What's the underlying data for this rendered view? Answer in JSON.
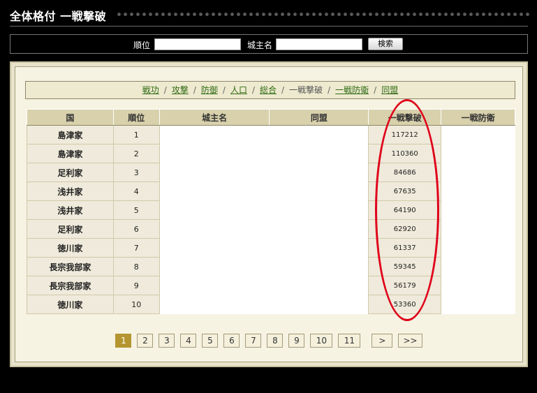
{
  "header": {
    "title": "全体格付 一戦撃破"
  },
  "search": {
    "rank_label": "順位",
    "lord_label": "城主名",
    "rank_value": "",
    "lord_value": "",
    "button_label": "検索"
  },
  "tabs": [
    {
      "label": "戦功",
      "active": false
    },
    {
      "label": "攻撃",
      "active": false
    },
    {
      "label": "防御",
      "active": false
    },
    {
      "label": "人口",
      "active": false
    },
    {
      "label": "総合",
      "active": false
    },
    {
      "label": "一戦撃破",
      "active": true
    },
    {
      "label": "一戦防衛",
      "active": false
    },
    {
      "label": "同盟",
      "active": false
    }
  ],
  "tab_separator": "/",
  "table": {
    "headers": [
      "国",
      "順位",
      "城主名",
      "同盟",
      "一戦撃破",
      "一戦防衛"
    ],
    "rows": [
      {
        "kuni": "島津家",
        "rank": "1",
        "lord": "",
        "alliance": "",
        "ikkou": "117212",
        "bouei": ""
      },
      {
        "kuni": "島津家",
        "rank": "2",
        "lord": "",
        "alliance": "",
        "ikkou": "110360",
        "bouei": ""
      },
      {
        "kuni": "足利家",
        "rank": "3",
        "lord": "",
        "alliance": "",
        "ikkou": "84686",
        "bouei": ""
      },
      {
        "kuni": "浅井家",
        "rank": "4",
        "lord": "",
        "alliance": "",
        "ikkou": "67635",
        "bouei": ""
      },
      {
        "kuni": "浅井家",
        "rank": "5",
        "lord": "",
        "alliance": "",
        "ikkou": "64190",
        "bouei": ""
      },
      {
        "kuni": "足利家",
        "rank": "6",
        "lord": "",
        "alliance": "",
        "ikkou": "62920",
        "bouei": ""
      },
      {
        "kuni": "徳川家",
        "rank": "7",
        "lord": "",
        "alliance": "",
        "ikkou": "61337",
        "bouei": ""
      },
      {
        "kuni": "長宗我部家",
        "rank": "8",
        "lord": "",
        "alliance": "",
        "ikkou": "59345",
        "bouei": ""
      },
      {
        "kuni": "長宗我部家",
        "rank": "9",
        "lord": "",
        "alliance": "",
        "ikkou": "56179",
        "bouei": ""
      },
      {
        "kuni": "徳川家",
        "rank": "10",
        "lord": "",
        "alliance": "",
        "ikkou": "53360",
        "bouei": ""
      }
    ]
  },
  "pagination": {
    "pages": [
      "1",
      "2",
      "3",
      "4",
      "5",
      "6",
      "7",
      "8",
      "9",
      "10",
      "11"
    ],
    "current": "1",
    "next_label": ">",
    "last_label": ">>"
  },
  "colors": {
    "highlight": "#e0001a",
    "active_page": "#b5952f",
    "link": "#2f6b14"
  }
}
